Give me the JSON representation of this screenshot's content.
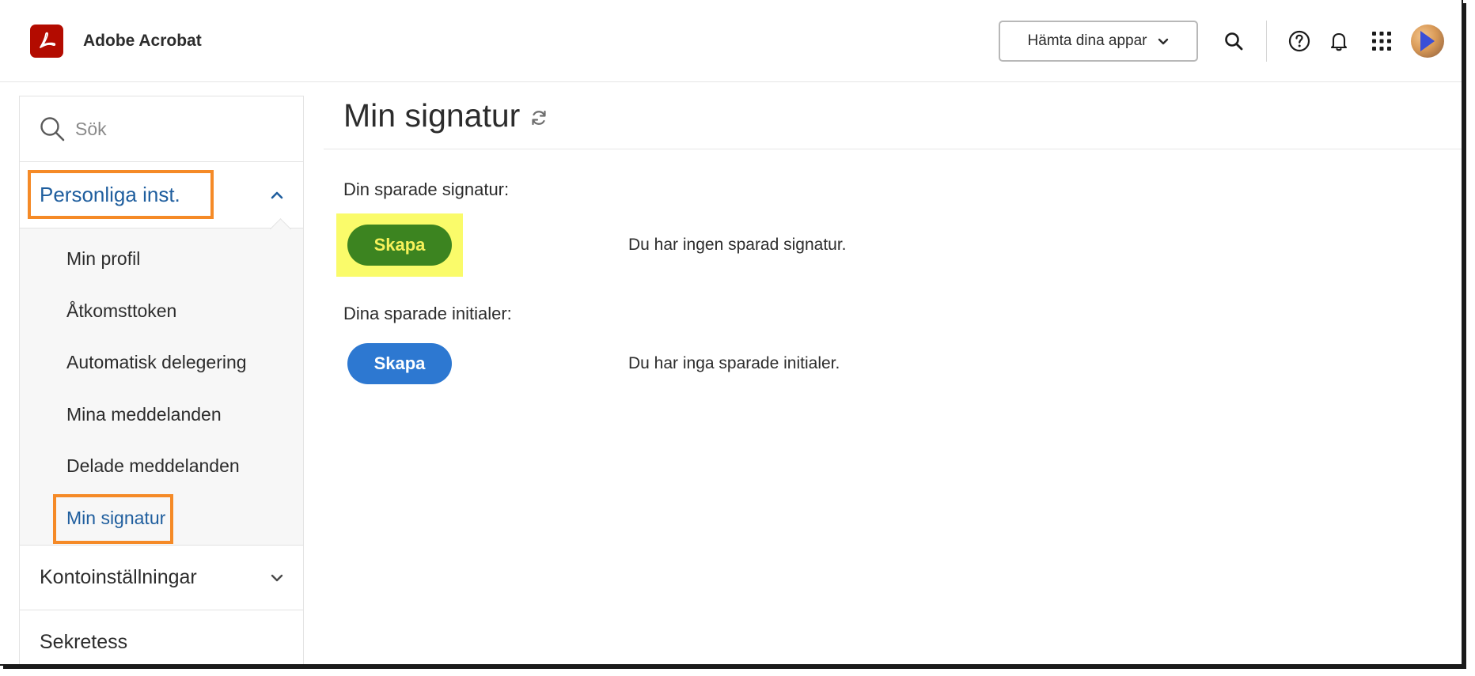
{
  "header": {
    "app_name": "Adobe Acrobat",
    "get_apps_label": "Hämta dina appar"
  },
  "sidebar": {
    "search_placeholder": "Sök",
    "sections": [
      {
        "label": "Personliga inst.",
        "expanded": true,
        "items": [
          {
            "label": "Min profil"
          },
          {
            "label": "Åtkomsttoken"
          },
          {
            "label": "Automatisk delegering"
          },
          {
            "label": "Mina meddelanden"
          },
          {
            "label": "Delade meddelanden"
          },
          {
            "label": "Min signatur",
            "active": true
          }
        ]
      },
      {
        "label": "Kontoinställningar",
        "expanded": false
      },
      {
        "label": "Sekretess"
      }
    ]
  },
  "main": {
    "title": "Min signatur",
    "signature": {
      "label": "Din sparade signatur:",
      "button": "Skapa",
      "note": "Du har ingen sparad signatur."
    },
    "initials": {
      "label": "Dina sparade initialer:",
      "button": "Skapa",
      "note": "Du har inga sparade initialer."
    }
  },
  "colors": {
    "accent_blue": "#2d78d1",
    "link_blue": "#1f5e9e",
    "highlight_orange": "#f58a27",
    "highlight_yellow": "#fafb6a",
    "create_green": "#3c8420",
    "acrobat_red": "#b30b00"
  },
  "icons": [
    "acrobat-logo-icon",
    "chevron-down-icon",
    "search-icon",
    "help-icon",
    "bell-icon",
    "apps-grid-icon",
    "refresh-icon",
    "chevron-up-icon"
  ]
}
